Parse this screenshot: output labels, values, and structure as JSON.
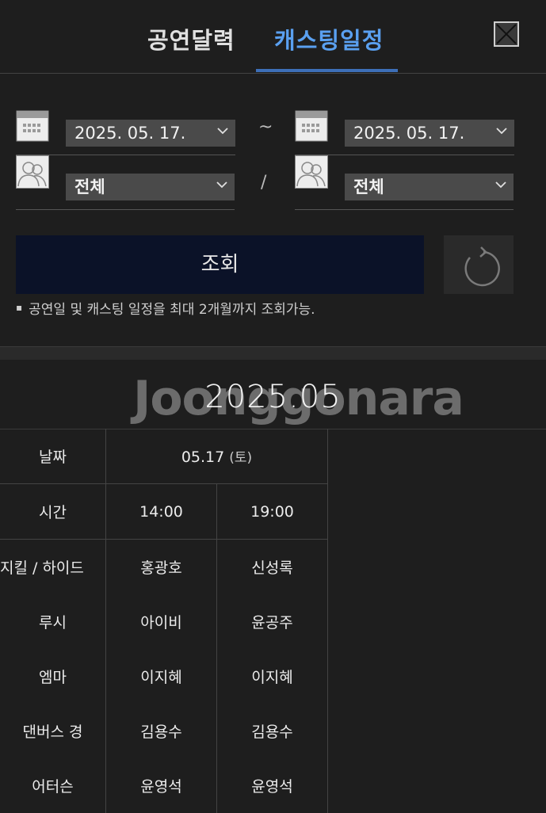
{
  "tabs": [
    {
      "label": "공연달력"
    },
    {
      "label": "캐스팅일정"
    }
  ],
  "filter": {
    "start_date": "2025. 05. 17.",
    "end_date": "2025. 05. 17.",
    "date_separator": "~",
    "cast_separator": "/",
    "cast_left": "전체",
    "cast_right": "전체"
  },
  "search": {
    "label": "조회"
  },
  "notice": "공연일 및 캐스팅 일정을 최대 2개월까지 조회가능.",
  "month": "2025.05",
  "watermark": "Joonggonara",
  "schedule": {
    "date_header": "날짜",
    "time_header": "시간",
    "date": "05.17",
    "day_of_week": "(토)",
    "times": [
      "14:00",
      "19:00"
    ],
    "roles": [
      {
        "role": "지킬 / 하이드",
        "cast": [
          "홍광호",
          "신성록"
        ]
      },
      {
        "role": "루시",
        "cast": [
          "아이비",
          "윤공주"
        ]
      },
      {
        "role": "엠마",
        "cast": [
          "이지혜",
          "이지혜"
        ]
      },
      {
        "role": "댄버스 경",
        "cast": [
          "김용수",
          "김용수"
        ]
      },
      {
        "role": "어터슨",
        "cast": [
          "윤영석",
          "윤영석"
        ]
      }
    ]
  },
  "colors": {
    "active_tab": "#5aa0f0",
    "search_button": "#0b1228"
  }
}
